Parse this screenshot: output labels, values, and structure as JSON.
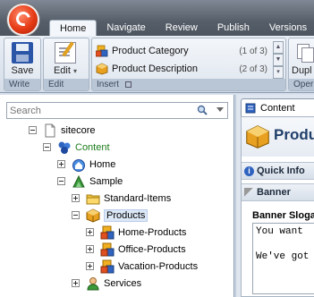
{
  "ribbon_tabs": [
    "Home",
    "Navigate",
    "Review",
    "Publish",
    "Versions"
  ],
  "write_group": {
    "label": "Write",
    "save_label": "Save"
  },
  "edit_group": {
    "label": "Edit",
    "edit_label": "Edit"
  },
  "insert_group": {
    "label": "Insert",
    "items": [
      {
        "label": "Product Category",
        "count": "(1 of 3)"
      },
      {
        "label": "Product Description",
        "count": "(2 of 3)"
      }
    ]
  },
  "partial_buttons": {
    "dupl": "Dupl",
    "oper": "Oper"
  },
  "search": {
    "placeholder": "Search"
  },
  "tree": [
    {
      "label": "sitecore",
      "toggle": "minus",
      "icon": "document-icon"
    },
    {
      "label": "Content",
      "toggle": "minus",
      "icon": "content-icon",
      "color": "#1d7c1d"
    },
    {
      "label": "Home",
      "toggle": "plus",
      "icon": "home-icon"
    },
    {
      "label": "Sample",
      "toggle": "minus",
      "icon": "sample-icon"
    },
    {
      "label": "Standard-Items",
      "toggle": "plus",
      "icon": "folder-icon"
    },
    {
      "label": "Products",
      "toggle": "minus",
      "icon": "products-icon",
      "selected": true
    },
    {
      "label": "Home-Products",
      "toggle": "plus",
      "icon": "category-icon"
    },
    {
      "label": "Office-Products",
      "toggle": "plus",
      "icon": "category-icon"
    },
    {
      "label": "Vacation-Products",
      "toggle": "plus",
      "icon": "category-icon"
    },
    {
      "label": "Services",
      "toggle": "plus",
      "icon": "services-icon"
    }
  ],
  "editor": {
    "tab_label": "Content",
    "item_title": "Produ",
    "sections": [
      "Quick Info",
      "Banner"
    ],
    "field_label": "Banner Sloga",
    "field_lines": [
      "You want",
      "",
      "We've got"
    ]
  }
}
